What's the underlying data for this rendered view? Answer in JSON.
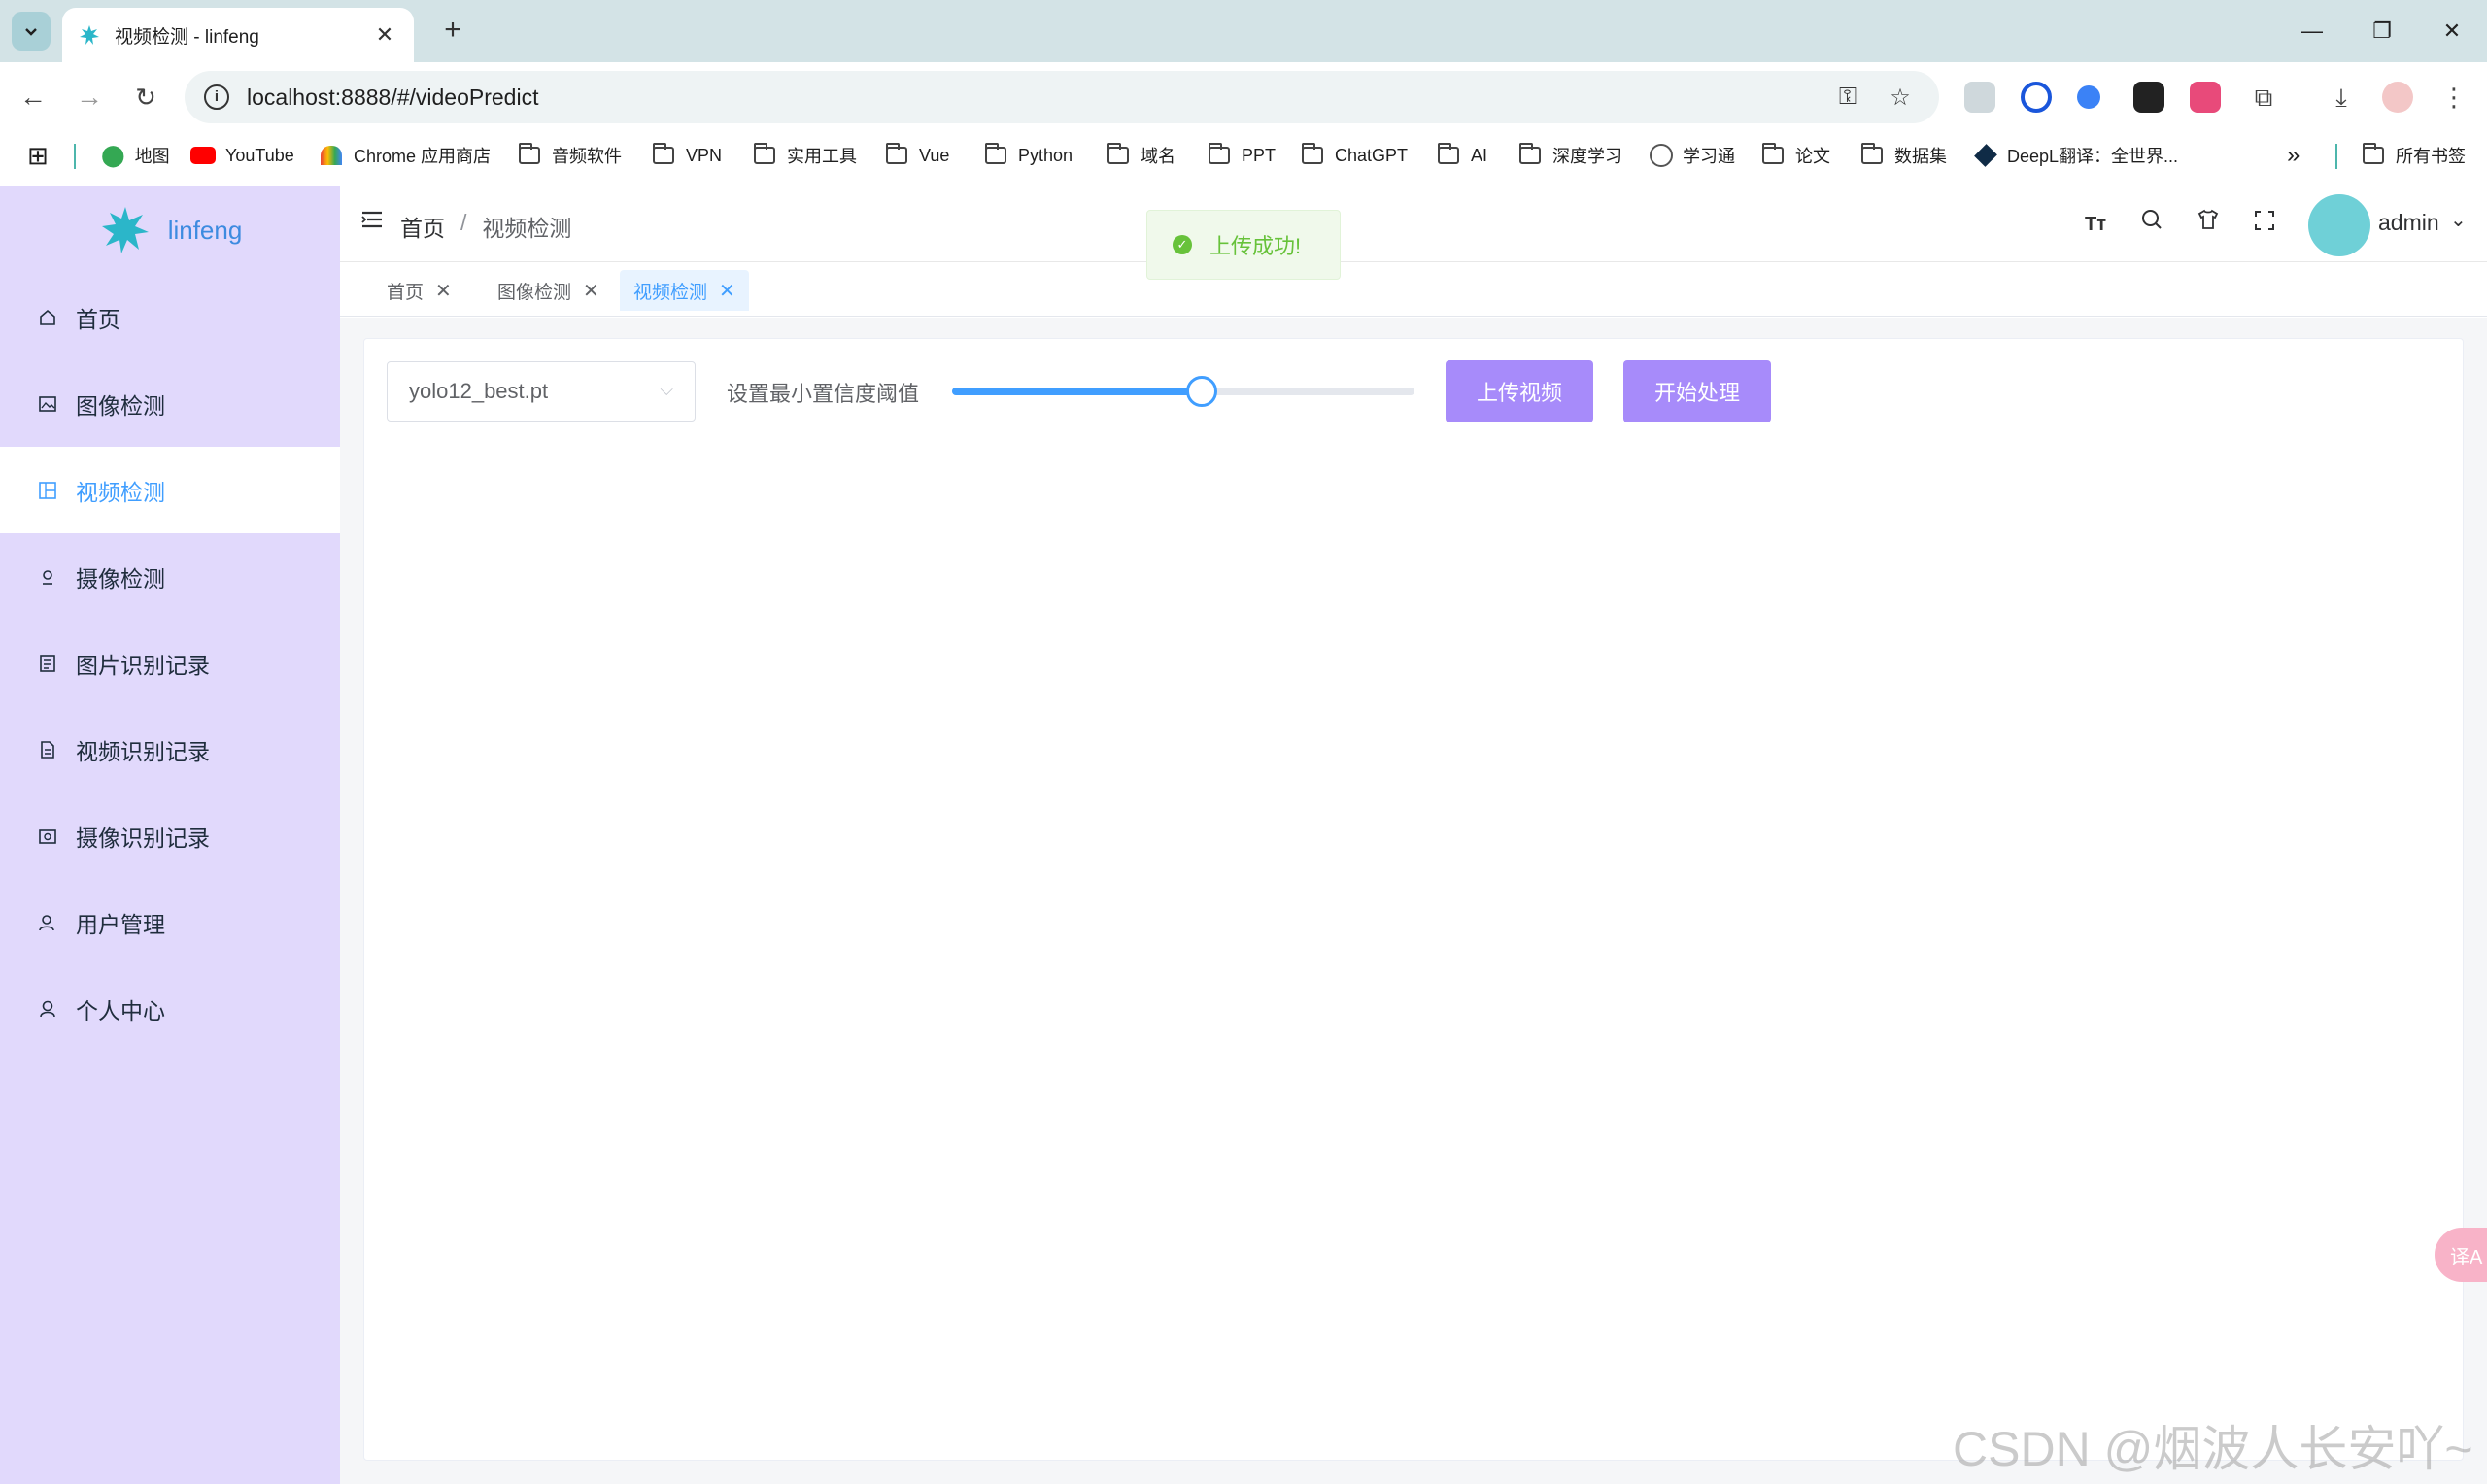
{
  "browser": {
    "tab_title": "视频检测 - linfeng",
    "url": "localhost:8888/#/videoPredict",
    "bookmarks": [
      "地图",
      "YouTube",
      "Chrome 应用商店",
      "音频软件",
      "VPN",
      "实用工具",
      "Vue",
      "Python",
      "域名",
      "PPT",
      "ChatGPT",
      "AI",
      "深度学习",
      "学习通",
      "论文",
      "数据集",
      "DeepL翻译：全世界...",
      "所有书签"
    ]
  },
  "app": {
    "logo_text": "linfeng",
    "menu": [
      {
        "label": "首页",
        "icon": "home-icon"
      },
      {
        "label": "图像检测",
        "icon": "picture-icon"
      },
      {
        "label": "视频检测",
        "icon": "video-icon",
        "active": true
      },
      {
        "label": "摄像检测",
        "icon": "camera-icon"
      },
      {
        "label": "图片识别记录",
        "icon": "record-icon"
      },
      {
        "label": "视频识别记录",
        "icon": "document-icon"
      },
      {
        "label": "摄像识别记录",
        "icon": "camera-record-icon"
      },
      {
        "label": "用户管理",
        "icon": "user-manage-icon"
      },
      {
        "label": "个人中心",
        "icon": "user-icon"
      }
    ],
    "breadcrumb": {
      "home": "首页",
      "sep": "/",
      "current": "视频检测"
    },
    "user": "admin",
    "tags": [
      {
        "label": "首页"
      },
      {
        "label": "图像检测"
      },
      {
        "label": "视频检测",
        "active": true
      }
    ],
    "toast": "上传成功!",
    "controls": {
      "model_select": "yolo12_best.pt",
      "threshold_label": "设置最小置信度阈值",
      "threshold_value": 0.54,
      "upload_button": "上传视频",
      "start_button": "开始处理"
    },
    "accent_color": "#409eff",
    "button_color": "#a78bfa",
    "sidebar_color": "#e1d9fc"
  },
  "watermark": "CSDN @烟波人长安吖~",
  "float_button": "译A"
}
